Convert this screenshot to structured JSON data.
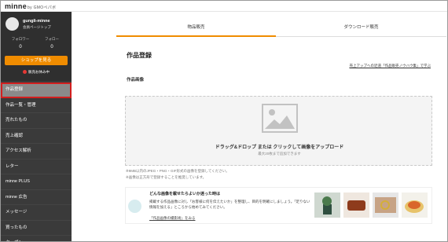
{
  "brand": {
    "logo": "minne",
    "logo_sub": "by GMOペパボ"
  },
  "user": {
    "name": "gungli-minne",
    "profile_link": "会員ページトップ"
  },
  "stats": [
    {
      "label": "フォロワー",
      "value": "0"
    },
    {
      "label": "フォロー",
      "value": "0"
    }
  ],
  "shop_button": "ショップを見る",
  "sales_link": "販売お休み中",
  "menu": [
    {
      "label": "作品登録",
      "active": true
    },
    {
      "label": "作品一覧・管理"
    },
    {
      "label": "売れたもの"
    },
    {
      "label": "売上確認"
    },
    {
      "label": "アクセス解析"
    },
    {
      "label": "レター"
    },
    {
      "label": "minne PLUS"
    },
    {
      "label": "minne 広告"
    },
    {
      "label": "メッセージ"
    },
    {
      "label": "買ったもの"
    },
    {
      "label": "クーポン"
    }
  ],
  "tabs": [
    {
      "label": "物品販売",
      "active": true
    },
    {
      "label": "ダウンロード販売"
    }
  ],
  "page_title": "作品登録",
  "guide_link": "売上アップへの近道「作品販売ノウハウ集」で学ぶ",
  "section_image": "作品画像",
  "dropzone": {
    "text": "ドラッグ&ドロップ または クリックして画像をアップロード",
    "sub": "最大20枚まで追加できます"
  },
  "notes": [
    "※9MB以内のJPEG・PNG・GIF形式の画像を登録してください。",
    "※画像は正方形で登録することを推奨しています。"
  ],
  "tip": {
    "title": "どんな画像を載せたらよいか迷った時は",
    "body": "掲載する作品画像に対し「お客様に何を伝えたいか」を整理し、目的を明確にしましょう。「足りない情報を加える」ところから始めてみてください。",
    "link": "「作品画像の撮影術」をみる"
  },
  "colors": {
    "accent": "#f08c00",
    "sidebar": "#3a3a3a",
    "highlight": "#d21f1f"
  }
}
